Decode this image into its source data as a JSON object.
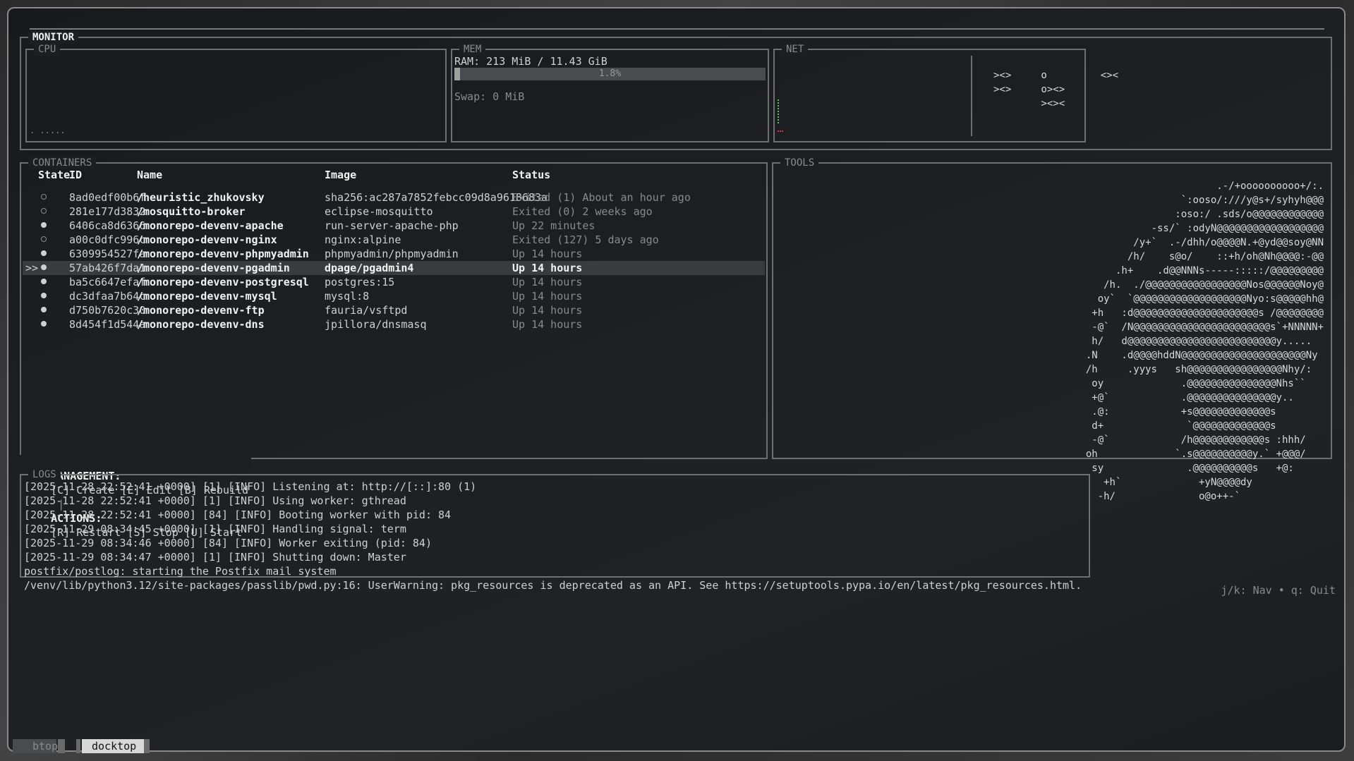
{
  "monitor": {
    "title": "MONITOR",
    "cpu": {
      "label": "CPU",
      "spark": ". ....."
    },
    "mem": {
      "label": "MEM",
      "ram": "RAM: 213 MiB / 11.43 GiB",
      "percent": "1.8%",
      "percent_value": 1.8,
      "swap": "Swap: 0 MiB"
    },
    "net": {
      "label": "NET",
      "art": "><>     o         <><\n><>     o><>\n        ><><"
    }
  },
  "containers": {
    "title": "CONTAINERS",
    "headers": {
      "state": "State",
      "id": "ID",
      "name": "Name",
      "image": "Image",
      "status": "Status"
    },
    "cursor": ">>",
    "rows": [
      {
        "running": false,
        "id": "8ad0edf00b6f",
        "name": "/heuristic_zhukovsky",
        "image": "sha256:ac287a7852febcc09d8a9618683a",
        "status": "Exited (1) About an hour ago"
      },
      {
        "running": false,
        "id": "281e177d3832",
        "name": "/mosquitto-broker",
        "image": "eclipse-mosquitto",
        "status": "Exited (0) 2 weeks ago"
      },
      {
        "running": true,
        "id": "6406ca8d6366",
        "name": "/monorepo-devenv-apache",
        "image": "run-server-apache-php",
        "status": "Up 22 minutes"
      },
      {
        "running": false,
        "id": "a00c0dfc996c",
        "name": "/monorepo-devenv-nginx",
        "image": "nginx:alpine",
        "status": "Exited (127) 5 days ago"
      },
      {
        "running": true,
        "id": "6309954527fa",
        "name": "/monorepo-devenv-phpmyadmin",
        "image": "phpmyadmin/phpmyadmin",
        "status": "Up 14 hours"
      },
      {
        "running": true,
        "id": "57ab426f7da1",
        "name": "/monorepo-devenv-pgadmin",
        "image": "dpage/pgadmin4",
        "status": "Up 14 hours",
        "selected": true
      },
      {
        "running": true,
        "id": "ba5c6647efaf",
        "name": "/monorepo-devenv-postgresql",
        "image": "postgres:15",
        "status": "Up 14 hours"
      },
      {
        "running": true,
        "id": "dc3dfaa7b64c",
        "name": "/monorepo-devenv-mysql",
        "image": "mysql:8",
        "status": "Up 14 hours"
      },
      {
        "running": true,
        "id": "d750b7620c30",
        "name": "/monorepo-devenv-ftp",
        "image": "fauria/vsftpd",
        "status": "Up 14 hours"
      },
      {
        "running": true,
        "id": "8d454f1d544a",
        "name": "/monorepo-devenv-dns",
        "image": "jpillora/dnsmasq",
        "status": "Up 14 hours"
      }
    ]
  },
  "tools": {
    "title": "TOOLS",
    "art": ".-/+oooooooooo+/:.\n`:ooso/:///y@s+/syhyh@@@\n:oso:/ .sds/o@@@@@@@@@@@@\n-ss/` :odyN@@@@@@@@@@@@@@@@@@\n/y+`  .-/dhh/o@@@@N.+@yd@@soy@NN\n/h/    s@o/    ::+h/oh@Nh@@@@:-@@\n.h+    .d@@NNNs-----:::::/@@@@@@@@@\n/h.  ./@@@@@@@@@@@@@@@@@Nos@@@@@@Noy@\noy`  `@@@@@@@@@@@@@@@@@@@Nyo:s@@@@@hh@\n+h   :d@@@@@@@@@@@@@@@@@@@@@s /@@@@@@@@\n-@`  /N@@@@@@@@@@@@@@@@@@@@@@@s`+NNNNN+\nh/   d@@@@@@@@@@@@@@@@@@@@@@@@@y.....  \n.N    .d@@@@hddN@@@@@@@@@@@@@@@@@@@@@Ny \n/h     .yyys   sh@@@@@@@@@@@@@@@@Nhy/:  \noy             .@@@@@@@@@@@@@@@Nhs``   \n+@`            .@@@@@@@@@@@@@@@y..     \n.@:            +s@@@@@@@@@@@@@s        \nd+              `@@@@@@@@@@@@@s        \n-@`            /h@@@@@@@@@@@@s :hhh/   \noh             `.s@@@@@@@@@@y.` +@@@/   \nsy              .@@@@@@@@@@s   +@:     \n+h`             +yN@@@@dy            \n-h/              o@o++-`              "
  },
  "actions": {
    "management_label": "MANAGEMENT:",
    "management": "[C] Create [E] Edit [B] Rebuild",
    "separator": "|",
    "actions_label": "ACTIONS:",
    "actions": "[R] Restart [S] Stop [U] Start"
  },
  "logs": {
    "title": "LOGS",
    "lines": [
      "[2025-11-28 22:52:41 +0000] [1] [INFO] Listening at: http://[::]:80 (1)",
      "[2025-11-28 22:52:41 +0000] [1] [INFO] Using worker: gthread",
      "[2025-11-28 22:52:41 +0000] [84] [INFO] Booting worker with pid: 84",
      "[2025-11-29 08:34:45 +0000] [1] [INFO] Handling signal: term",
      "[2025-11-29 08:34:46 +0000] [84] [INFO] Worker exiting (pid: 84)",
      "[2025-11-29 08:34:47 +0000] [1] [INFO] Shutting down: Master",
      "postfix/postlog: starting the Postfix mail system",
      "/venv/lib/python3.12/site-packages/passlib/pwd.py:16: UserWarning: pkg_resources is deprecated as an API. See https://setuptools.pypa.io/en/latest/pkg_resources.html. The pkg_resources package is slated"
    ]
  },
  "help": "j/k: Nav • q: Quit",
  "tabs": [
    {
      "label": "btop",
      "active": false
    },
    {
      "label": "docktop",
      "active": true
    }
  ]
}
